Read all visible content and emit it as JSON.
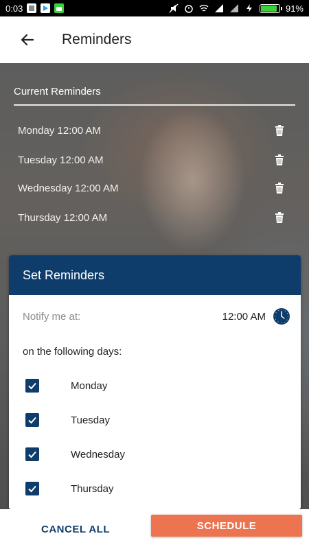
{
  "status_bar": {
    "time": "0:03",
    "battery_percent": "91%",
    "battery_level": 0.91,
    "battery_color": "#3ad13a"
  },
  "app_bar": {
    "title": "Reminders",
    "back_icon": "arrow-left-icon"
  },
  "current_reminders": {
    "title": "Current Reminders",
    "items": [
      {
        "label": "Monday 12:00 AM"
      },
      {
        "label": "Tuesday 12:00 AM"
      },
      {
        "label": "Wednesday 12:00 AM"
      },
      {
        "label": "Thursday 12:00 AM"
      }
    ]
  },
  "set_reminders": {
    "title": "Set Reminders",
    "notify_label": "Notify me at:",
    "notify_time": "12:00 AM",
    "days_label": "on the following days:",
    "days": [
      {
        "label": "Monday",
        "checked": true
      },
      {
        "label": "Tuesday",
        "checked": true
      },
      {
        "label": "Wednesday",
        "checked": true
      },
      {
        "label": "Thursday",
        "checked": true
      }
    ]
  },
  "actions": {
    "cancel_label": "CANCEL ALL",
    "schedule_label": "SCHEDULE"
  },
  "colors": {
    "primary": "#0f3d6b",
    "accent": "#ed7450"
  }
}
